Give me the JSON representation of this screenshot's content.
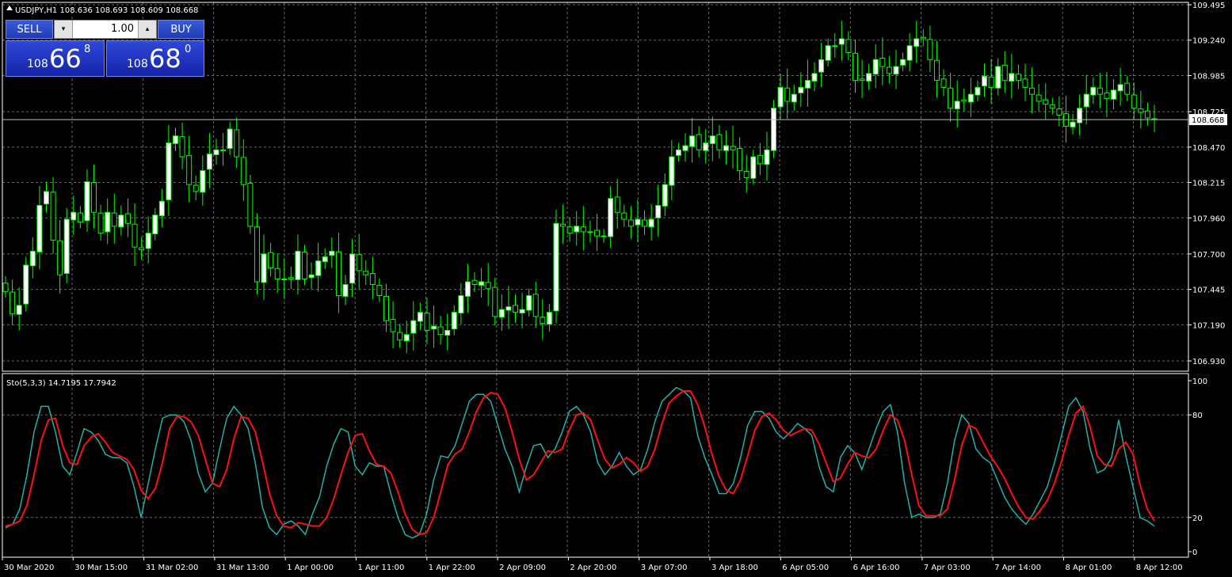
{
  "chart_data": [
    {
      "type": "candlestick",
      "symbol_line": "USDJPY,H1  108.636 108.693 108.609 108.668",
      "bid_label": "108.668",
      "bid_value": 108.668,
      "ylim": [
        106.84,
        109.51
      ],
      "y_ticks": [
        "109.495",
        "109.240",
        "108.985",
        "108.725",
        "108.470",
        "108.215",
        "107.960",
        "107.700",
        "107.445",
        "107.190",
        "106.930"
      ],
      "closes": [
        107.43,
        107.27,
        107.33,
        107.62,
        107.72,
        108.05,
        108.15,
        107.8,
        107.55,
        107.95,
        108.0,
        107.93,
        108.22,
        108.0,
        107.85,
        108.0,
        107.9,
        107.98,
        107.92,
        107.75,
        107.73,
        107.85,
        107.98,
        108.08,
        108.5,
        108.55,
        108.4,
        108.2,
        108.15,
        108.3,
        108.42,
        108.45,
        108.45,
        108.6,
        108.4,
        108.2,
        107.9,
        107.5,
        107.7,
        107.6,
        107.52,
        107.52,
        107.52,
        107.72,
        107.52,
        107.55,
        107.65,
        107.68,
        107.72,
        107.4,
        107.48,
        107.7,
        107.58,
        107.55,
        107.48,
        107.4,
        107.22,
        107.14,
        107.08,
        107.12,
        107.22,
        107.28,
        107.15,
        107.18,
        107.12,
        107.15,
        107.28,
        107.4,
        107.5,
        107.48,
        107.5,
        107.45,
        107.25,
        107.3,
        107.32,
        107.28,
        107.3,
        107.4,
        107.25,
        107.2,
        107.28,
        107.92,
        107.9,
        107.85,
        107.9,
        107.86,
        107.86,
        107.83,
        107.83,
        108.1,
        108.0,
        107.95,
        107.9,
        107.95,
        107.9,
        107.95,
        108.05,
        108.2,
        108.4,
        108.45,
        108.48,
        108.55,
        108.45,
        108.5,
        108.55,
        108.45,
        108.48,
        108.45,
        108.3,
        108.25,
        108.4,
        108.35,
        108.45,
        108.75,
        108.9,
        108.8,
        108.85,
        108.9,
        108.95,
        109.0,
        109.1,
        109.2,
        109.2,
        109.25,
        109.15,
        108.95,
        108.95,
        109.0,
        109.1,
        109.05,
        109.0,
        109.05,
        109.1,
        109.2,
        109.25,
        109.25,
        109.1,
        108.95,
        108.9,
        108.75,
        108.8,
        108.8,
        108.85,
        108.9,
        108.98,
        108.9,
        109.05,
        108.95,
        109.0,
        108.95,
        108.9,
        108.85,
        108.8,
        108.78,
        108.75,
        108.7,
        108.62,
        108.65,
        108.75,
        108.85,
        108.9,
        108.85,
        108.82,
        108.88,
        108.92,
        108.85,
        108.75,
        108.72,
        108.68,
        108.668
      ],
      "x_labels": [
        "30 Mar 2020",
        "30 Mar 15:00",
        "31 Mar 02:00",
        "31 Mar 13:00",
        "1 Apr 00:00",
        "1 Apr 11:00",
        "1 Apr 22:00",
        "2 Apr 09:00",
        "2 Apr 20:00",
        "3 Apr 07:00",
        "3 Apr 18:00",
        "6 Apr 05:00",
        "6 Apr 16:00",
        "7 Apr 03:00",
        "7 Apr 14:00",
        "8 Apr 01:00",
        "8 Apr 12:00"
      ]
    },
    {
      "type": "line",
      "indicator_label": "Sto(5,3,3) 14.7195 17.7942",
      "ylim": [
        0,
        100
      ],
      "y_ticks": [
        "100",
        "80",
        "20",
        "0"
      ],
      "levels": [
        20,
        80
      ],
      "series": [
        {
          "color": "#20b2aa",
          "values": [
            14,
            16,
            25,
            45,
            70,
            85,
            85,
            70,
            50,
            45,
            58,
            72,
            70,
            65,
            57,
            55,
            55,
            52,
            38,
            20,
            40,
            60,
            78,
            80,
            80,
            76,
            65,
            46,
            35,
            40,
            60,
            78,
            85,
            80,
            72,
            52,
            26,
            14,
            10,
            16,
            18,
            15,
            10,
            22,
            32,
            50,
            63,
            72,
            70,
            50,
            45,
            52,
            50,
            50,
            34,
            20,
            10,
            8,
            10,
            22,
            42,
            56,
            55,
            62,
            75,
            88,
            92,
            92,
            88,
            74,
            60,
            50,
            35,
            50,
            62,
            63,
            55,
            60,
            70,
            82,
            85,
            80,
            70,
            52,
            45,
            50,
            58,
            50,
            45,
            48,
            60,
            76,
            88,
            92,
            96,
            94,
            90,
            68,
            55,
            45,
            34,
            34,
            40,
            55,
            74,
            82,
            82,
            78,
            70,
            66,
            70,
            75,
            72,
            68,
            50,
            38,
            35,
            55,
            62,
            58,
            48,
            60,
            72,
            82,
            86,
            70,
            40,
            20,
            22,
            20,
            20,
            22,
            40,
            65,
            80,
            75,
            60,
            55,
            52,
            42,
            32,
            25,
            20,
            16,
            22,
            30,
            38,
            52,
            68,
            85,
            90,
            82,
            60,
            46,
            48,
            55,
            77,
            56,
            38,
            20,
            18,
            15
          ]
        },
        {
          "color": "#ff1010",
          "values": [
            15,
            16,
            18,
            27,
            45,
            65,
            77,
            78,
            62,
            52,
            51,
            62,
            67,
            69,
            64,
            58,
            56,
            54,
            48,
            36,
            31,
            37,
            52,
            72,
            79,
            79,
            76,
            68,
            54,
            40,
            38,
            48,
            66,
            79,
            78,
            70,
            53,
            34,
            21,
            15,
            14,
            17,
            16,
            15,
            15,
            20,
            31,
            45,
            58,
            68,
            69,
            59,
            51,
            50,
            46,
            35,
            22,
            13,
            10,
            11,
            20,
            35,
            51,
            57,
            60,
            70,
            82,
            90,
            93,
            92,
            84,
            70,
            54,
            42,
            45,
            52,
            59,
            58,
            60,
            71,
            80,
            81,
            77,
            65,
            54,
            49,
            51,
            55,
            52,
            47,
            50,
            60,
            75,
            87,
            91,
            94,
            94,
            86,
            73,
            57,
            44,
            36,
            34,
            42,
            56,
            71,
            79,
            81,
            77,
            71,
            68,
            70,
            72,
            71,
            63,
            52,
            41,
            43,
            51,
            58,
            56,
            55,
            60,
            71,
            80,
            77,
            65,
            45,
            27,
            21,
            21,
            21,
            25,
            42,
            62,
            74,
            72,
            64,
            56,
            50,
            43,
            34,
            26,
            20,
            19,
            24,
            30,
            40,
            53,
            68,
            81,
            85,
            73,
            56,
            51,
            50,
            60,
            64,
            57,
            39,
            25,
            18
          ]
        }
      ]
    }
  ],
  "trade_panel": {
    "sell_label": "SELL",
    "buy_label": "BUY",
    "lot": "1.00",
    "sell_small": "108",
    "sell_big": "66",
    "sell_sup": "8",
    "buy_small": "108",
    "buy_big": "68",
    "buy_sup": "0",
    "up_glyph": "▴",
    "down_glyph": "▾"
  },
  "colors": {
    "background": "#000000",
    "grid": "#6b6b6b",
    "bull_candle": "#ffffff",
    "bear_candle": "#000000",
    "wick": "#00ff00",
    "stoch_main": "#20b2aa",
    "stoch_signal": "#ff1010"
  }
}
